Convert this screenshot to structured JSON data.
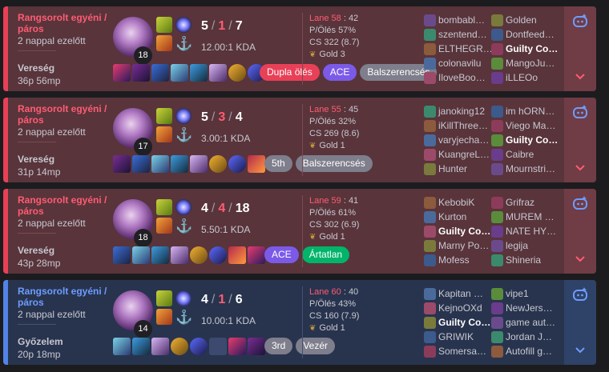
{
  "colors": {
    "loss_bg": "#59343b",
    "win_bg": "#28344e",
    "loss_accent": "#e84057",
    "win_accent": "#5383e8"
  },
  "icons": {
    "action": "ai-assistant-icon",
    "expand": "chevron-down-icon",
    "tier": "laurel-icon"
  },
  "matches": [
    {
      "outcome": "loss",
      "queue": "Rangsorolt egyéni / páros",
      "time_ago": "2 nappal ezelőtt",
      "result": "Vereség",
      "duration": "36p 56mp",
      "level": "18",
      "kills": "5",
      "deaths": "1",
      "assists": "7",
      "kda_ratio": "12.00:1 KDA",
      "badges": [
        {
          "text": "Dupla ölés",
          "color": "red"
        },
        {
          "text": "ACE",
          "color": "purple"
        },
        {
          "text": "Balszerencsés",
          "color": "gray"
        }
      ],
      "lane_label": "Lane 58",
      "lane_value": "42",
      "kill_participation": "P/Ölés 57%",
      "cs": "CS 322 (8.7)",
      "tier": "Gold 3",
      "team_a": [
        "bombabl…",
        "szentend…",
        "ELTHEGR…",
        "colonavilu",
        "IloveBoo…"
      ],
      "team_b": [
        "Golden",
        "Dontfeed…",
        "Guilty Co…",
        "MangoJu…",
        "iLLEOo"
      ],
      "me_team": "b",
      "me_index": 2,
      "item_empty": -1
    },
    {
      "outcome": "loss",
      "queue": "Rangsorolt egyéni / páros",
      "time_ago": "2 nappal ezelőtt",
      "result": "Vereség",
      "duration": "31p 14mp",
      "level": "17",
      "kills": "5",
      "deaths": "3",
      "assists": "4",
      "kda_ratio": "3.00:1 KDA",
      "badges": [
        {
          "text": "5th",
          "color": "gray"
        },
        {
          "text": "Balszerencsés",
          "color": "gray"
        }
      ],
      "lane_label": "Lane 55",
      "lane_value": "45",
      "kill_participation": "P/Ölés 32%",
      "cs": "CS 269 (8.6)",
      "tier": "Gold 1",
      "team_a": [
        "janoking12",
        "iKillThree…",
        "varyjecha…",
        "KuangreL…",
        "Hunter"
      ],
      "team_b": [
        "im hORN…",
        "Viego Ma…",
        "Guilty Co…",
        "Caibre",
        "Mournstri…"
      ],
      "me_team": "b",
      "me_index": 2,
      "item_empty": -1
    },
    {
      "outcome": "loss",
      "queue": "Rangsorolt egyéni / páros",
      "time_ago": "2 nappal ezelőtt",
      "result": "Vereség",
      "duration": "43p 28mp",
      "level": "18",
      "kills": "4",
      "deaths": "4",
      "assists": "18",
      "kda_ratio": "5.50:1 KDA",
      "badges": [
        {
          "text": "ACE",
          "color": "purple"
        },
        {
          "text": "Ártatlan",
          "color": "green"
        }
      ],
      "lane_label": "Lane 59",
      "lane_value": "41",
      "kill_participation": "P/Ölés 61%",
      "cs": "CS 302 (6.9)",
      "tier": "Gold 1",
      "team_a": [
        "KebobiK",
        "Kurton",
        "Guilty Co…",
        "Marny Po…",
        "Mofess"
      ],
      "team_b": [
        "Grifraz",
        "MUREM …",
        "NATE HY…",
        "legija",
        "Shineria"
      ],
      "me_team": "a",
      "me_index": 2,
      "item_empty": -1
    },
    {
      "outcome": "win",
      "queue": "Rangsorolt egyéni / páros",
      "time_ago": "2 nappal ezelőtt",
      "result": "Győzelem",
      "duration": "20p 18mp",
      "level": "14",
      "kills": "4",
      "deaths": "1",
      "assists": "6",
      "kda_ratio": "10.00:1 KDA",
      "badges": [
        {
          "text": "3rd",
          "color": "gray"
        },
        {
          "text": "Vezér",
          "color": "gray"
        }
      ],
      "lane_label": "Lane 60",
      "lane_value": "40",
      "kill_participation": "P/Ölés 43%",
      "cs": "CS 160 (7.9)",
      "tier": "Gold 1",
      "team_a": [
        "Kapitan …",
        "KejnoOXd",
        "Guilty Co…",
        "GRIWIK",
        "Somersa…"
      ],
      "team_b": [
        "vipe1",
        "NewJers…",
        "game aut…",
        "Jordan J…",
        "Autofill g…"
      ],
      "me_team": "a",
      "me_index": 2,
      "item_empty": 5
    }
  ]
}
